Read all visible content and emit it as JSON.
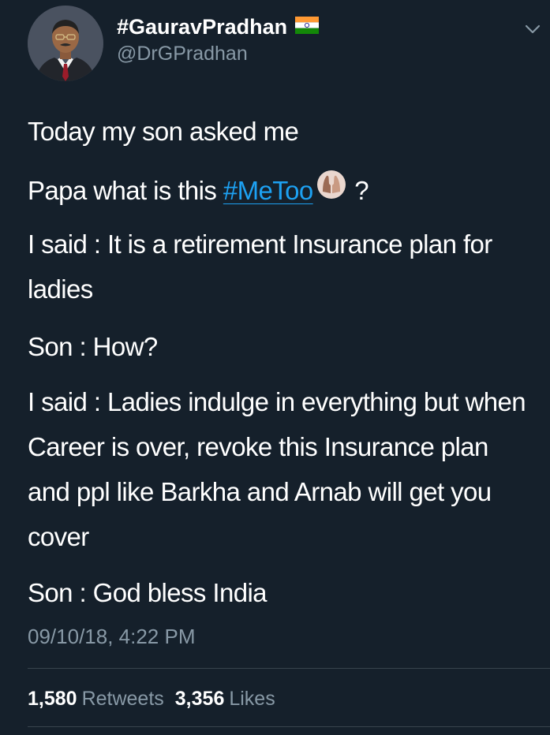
{
  "tweet": {
    "display_name": "#GauravPradhan",
    "handle": "@DrGPradhan",
    "lines": {
      "line1": "Today my son asked me",
      "line2_before": "Papa what is this ",
      "line2_hashtag": "#MeToo",
      "line2_after": " ?",
      "line3": "I said : It is a retirement Insurance plan for ladies",
      "line4": "Son : How?",
      "line5": "I said : Ladies indulge in everything but when Career is over, revoke this Insurance plan and ppl like Barkha and Arnab will get you cover",
      "line6": "Son : God bless India"
    },
    "timestamp": "09/10/18, 4:22 PM",
    "stats": {
      "retweets_count": "1,580",
      "retweets_label": "Retweets",
      "likes_count": "3,356",
      "likes_label": "Likes"
    },
    "icons": {
      "flag": "india-flag-icon",
      "hands": "raised-hands-icon",
      "menu": "chevron-down-icon"
    },
    "colors": {
      "background": "#15202b",
      "link": "#1da1f2",
      "secondary_text": "#8899a6",
      "divider": "#38444d"
    }
  }
}
